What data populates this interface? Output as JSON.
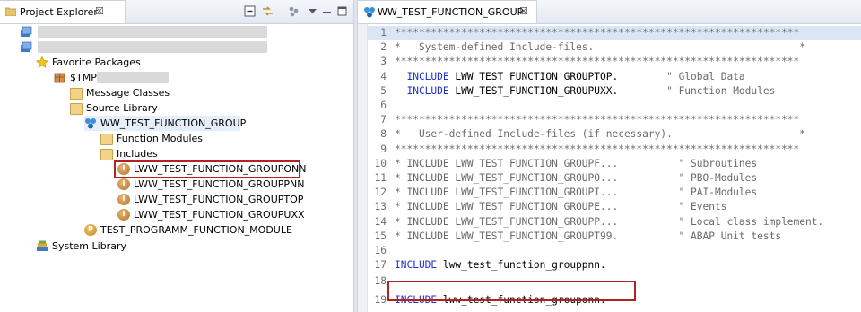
{
  "explorer": {
    "tab_label": "Project Explorer",
    "close_glyph": "☒",
    "tree": {
      "favorite_packages": "Favorite Packages",
      "stmp": "$TMP",
      "message_classes": "Message Classes",
      "source_library": "Source Library",
      "function_group": "WW_TEST_FUNCTION_GROUP",
      "function_modules": "Function Modules",
      "includes": "Includes",
      "include_items": [
        "LWW_TEST_FUNCTION_GROUPONN",
        "LWW_TEST_FUNCTION_GROUPPNN",
        "LWW_TEST_FUNCTION_GROUPTOP",
        "LWW_TEST_FUNCTION_GROUPUXX"
      ],
      "program": "TEST_PROGRAMM_FUNCTION_MODULE",
      "system_library": "System Library"
    }
  },
  "editor": {
    "tab_label": "WW_TEST_FUNCTION_GROUP",
    "close_glyph": "☒",
    "lines": [
      {
        "n": "1",
        "t": "*******************************************************************",
        "s": "cmt"
      },
      {
        "n": "2",
        "t": "*   System-defined Include-files.                                  *",
        "s": "cmt"
      },
      {
        "n": "3",
        "t": "*******************************************************************",
        "s": "cmt"
      },
      {
        "n": "4",
        "kw": "  INCLUDE",
        "t": " LWW_TEST_FUNCTION_GROUPTOP.",
        "c": "        \" Global Data"
      },
      {
        "n": "5",
        "kw": "  INCLUDE",
        "t": " LWW_TEST_FUNCTION_GROUPUXX.",
        "c": "        \" Function Modules"
      },
      {
        "n": "6",
        "t": ""
      },
      {
        "n": "7",
        "t": "*******************************************************************",
        "s": "cmt"
      },
      {
        "n": "8",
        "t": "*   User-defined Include-files (if necessary).                     *",
        "s": "cmt"
      },
      {
        "n": "9",
        "t": "*******************************************************************",
        "s": "cmt"
      },
      {
        "n": "10",
        "t": "* INCLUDE LWW_TEST_FUNCTION_GROUPF...          \" Subroutines",
        "s": "cmt"
      },
      {
        "n": "11",
        "t": "* INCLUDE LWW_TEST_FUNCTION_GROUPO...          \" PBO-Modules",
        "s": "cmt"
      },
      {
        "n": "12",
        "t": "* INCLUDE LWW_TEST_FUNCTION_GROUPI...          \" PAI-Modules",
        "s": "cmt"
      },
      {
        "n": "13",
        "t": "* INCLUDE LWW_TEST_FUNCTION_GROUPE...          \" Events",
        "s": "cmt"
      },
      {
        "n": "14",
        "t": "* INCLUDE LWW_TEST_FUNCTION_GROUPP...          \" Local class implement.",
        "s": "cmt"
      },
      {
        "n": "15",
        "t": "* INCLUDE LWW_TEST_FUNCTION_GROUPT99.          \" ABAP Unit tests",
        "s": "cmt"
      },
      {
        "n": "16",
        "t": ""
      },
      {
        "n": "17",
        "kw": "INCLUDE",
        "t": " lww_test_function_grouppnn."
      },
      {
        "n": "18",
        "t": ""
      },
      {
        "n": "19",
        "kw": "INCLUDE",
        "t": " lww_test_function_grouponn."
      }
    ]
  }
}
